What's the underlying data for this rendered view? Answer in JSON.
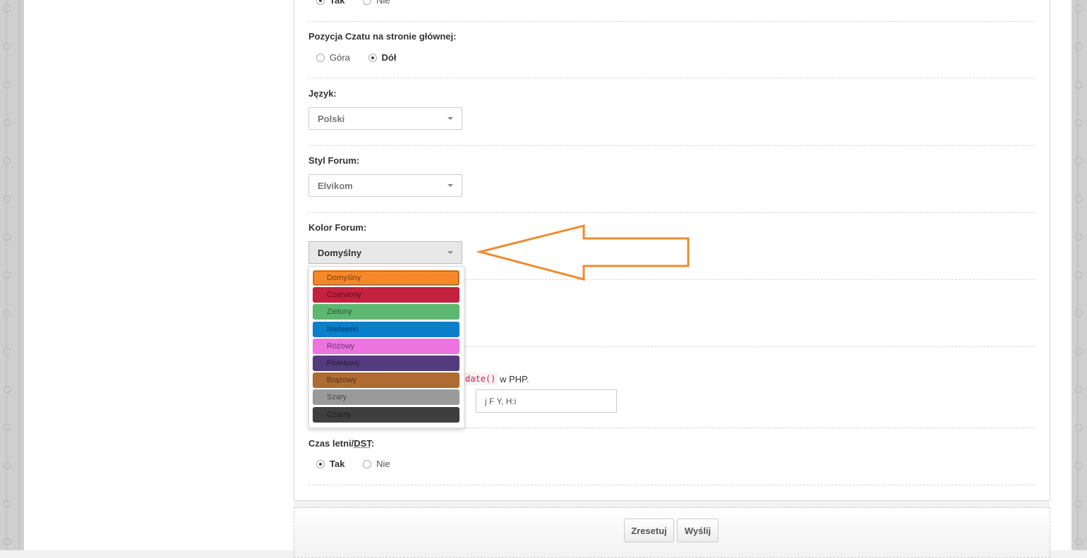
{
  "chat_visible": {
    "yes_label": "Tak",
    "no_label": "Nie",
    "selected": "Tak"
  },
  "chat_position": {
    "label": "Pozycja Czatu na stronie głównej:",
    "options": [
      "Góra",
      "Dół"
    ],
    "selected": "Dół"
  },
  "language": {
    "label": "Język:",
    "value": "Polski"
  },
  "forum_style": {
    "label": "Styl Forum:",
    "value": "Elvikom"
  },
  "forum_color": {
    "label": "Kolor Forum:",
    "value": "Domyślny",
    "options": [
      {
        "label": "Domyślny",
        "color": "#f5892a"
      },
      {
        "label": "Czerwony",
        "color": "#c4213f"
      },
      {
        "label": "Zielony",
        "color": "#5cb870"
      },
      {
        "label": "Niebieski",
        "color": "#0a7fcc"
      },
      {
        "label": "Różowy",
        "color": "#ec74e0"
      },
      {
        "label": "Fioletowy",
        "color": "#533c7e"
      },
      {
        "label": "Brązowy",
        "color": "#ae6c33"
      },
      {
        "label": "Szary",
        "color": "#9a9a9a"
      },
      {
        "label": "Czarny",
        "color": "#3f3f3f"
      }
    ]
  },
  "date_format": {
    "code": "date()",
    "suffix": "w PHP.",
    "value": "j F Y, H:i"
  },
  "dst": {
    "label_prefix": "Czas letni/",
    "label_abbr": "DST",
    "label_suffix": ":",
    "yes_label": "Tak",
    "no_label": "Nie",
    "selected": "Tak"
  },
  "footer": {
    "reset_label": "Zresetuj",
    "submit_label": "Wyślij"
  },
  "colors": {
    "annotation_arrow": "#f08a30"
  }
}
